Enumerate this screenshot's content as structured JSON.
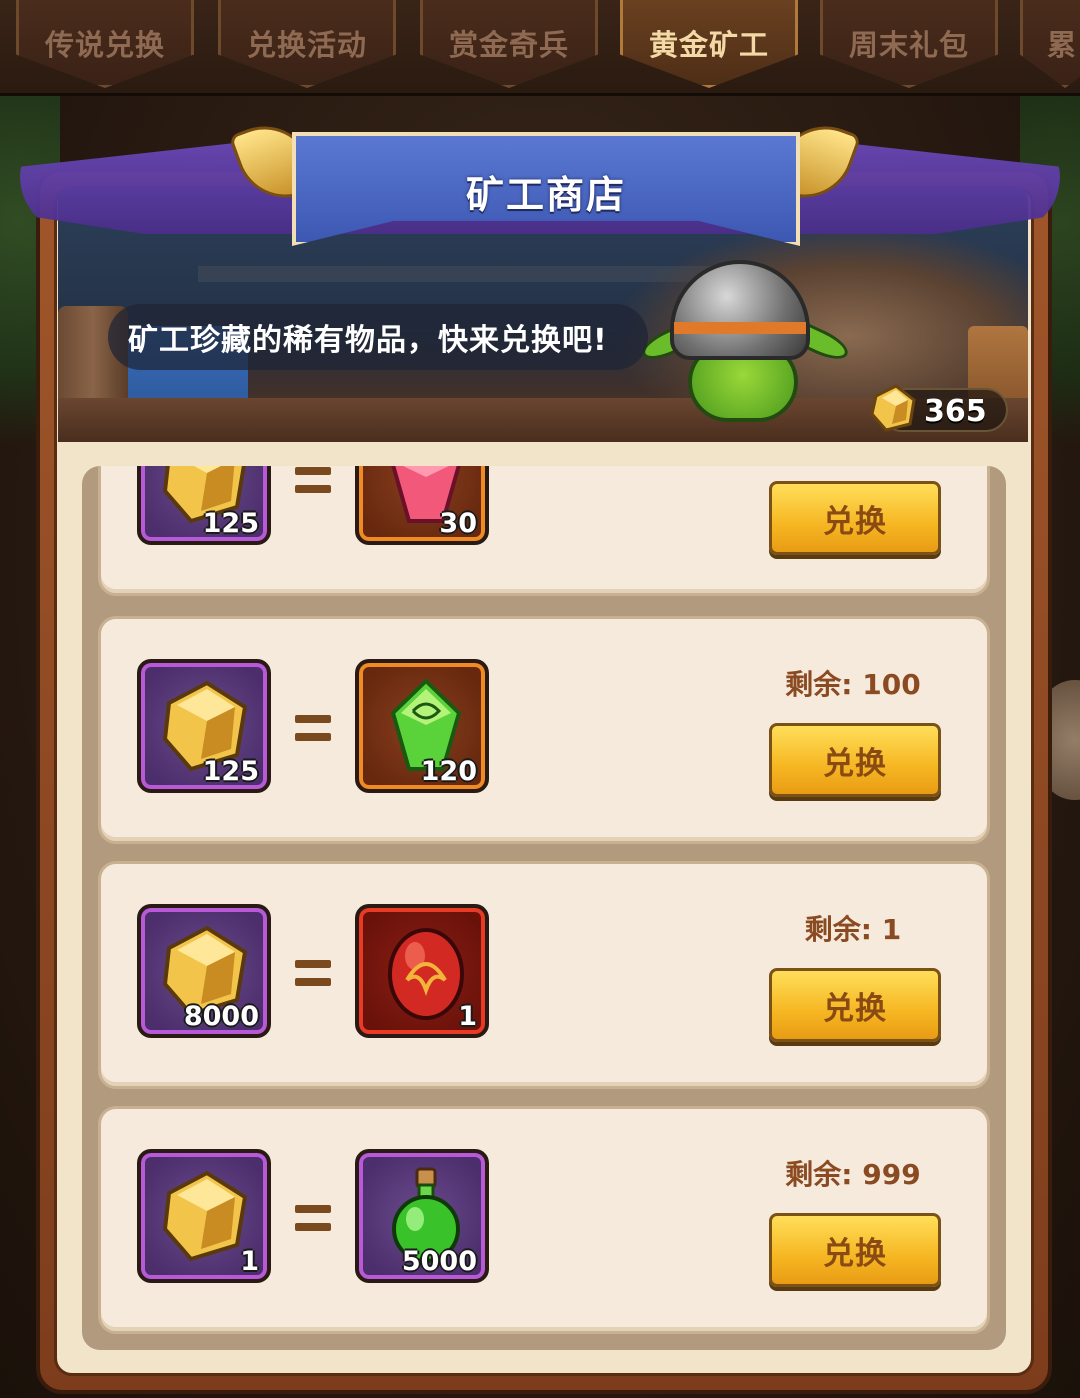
{
  "tabs": [
    {
      "label": "传说兑换",
      "active": false
    },
    {
      "label": "兑换活动",
      "active": false
    },
    {
      "label": "赏金奇兵",
      "active": false
    },
    {
      "label": "黄金矿工",
      "active": true
    },
    {
      "label": "周末礼包",
      "active": false
    },
    {
      "label": "累",
      "active": false
    }
  ],
  "shop": {
    "title": "矿工商店",
    "subtitle": "矿工珍藏的稀有物品，快来兑换吧!",
    "currency_amount": "365"
  },
  "items": [
    {
      "cost_qty": "125",
      "reward_qty": "30",
      "reward_icon": "pink-crystal-icon",
      "remaining": "",
      "button": "兑换"
    },
    {
      "cost_qty": "125",
      "reward_qty": "120",
      "reward_icon": "green-crystal-icon",
      "remaining": "剩余: 100",
      "button": "兑换"
    },
    {
      "cost_qty": "8000",
      "reward_qty": "1",
      "reward_icon": "red-dragon-egg-icon",
      "remaining": "剩余: 1",
      "button": "兑换"
    },
    {
      "cost_qty": "1",
      "reward_qty": "5000",
      "reward_icon": "green-potion-icon",
      "remaining": "剩余: 999",
      "button": "兑换"
    }
  ],
  "colors": {
    "accent_gold": "#f6b622",
    "title_blue": "#4a66c2",
    "remain_text": "#8a4a22"
  }
}
